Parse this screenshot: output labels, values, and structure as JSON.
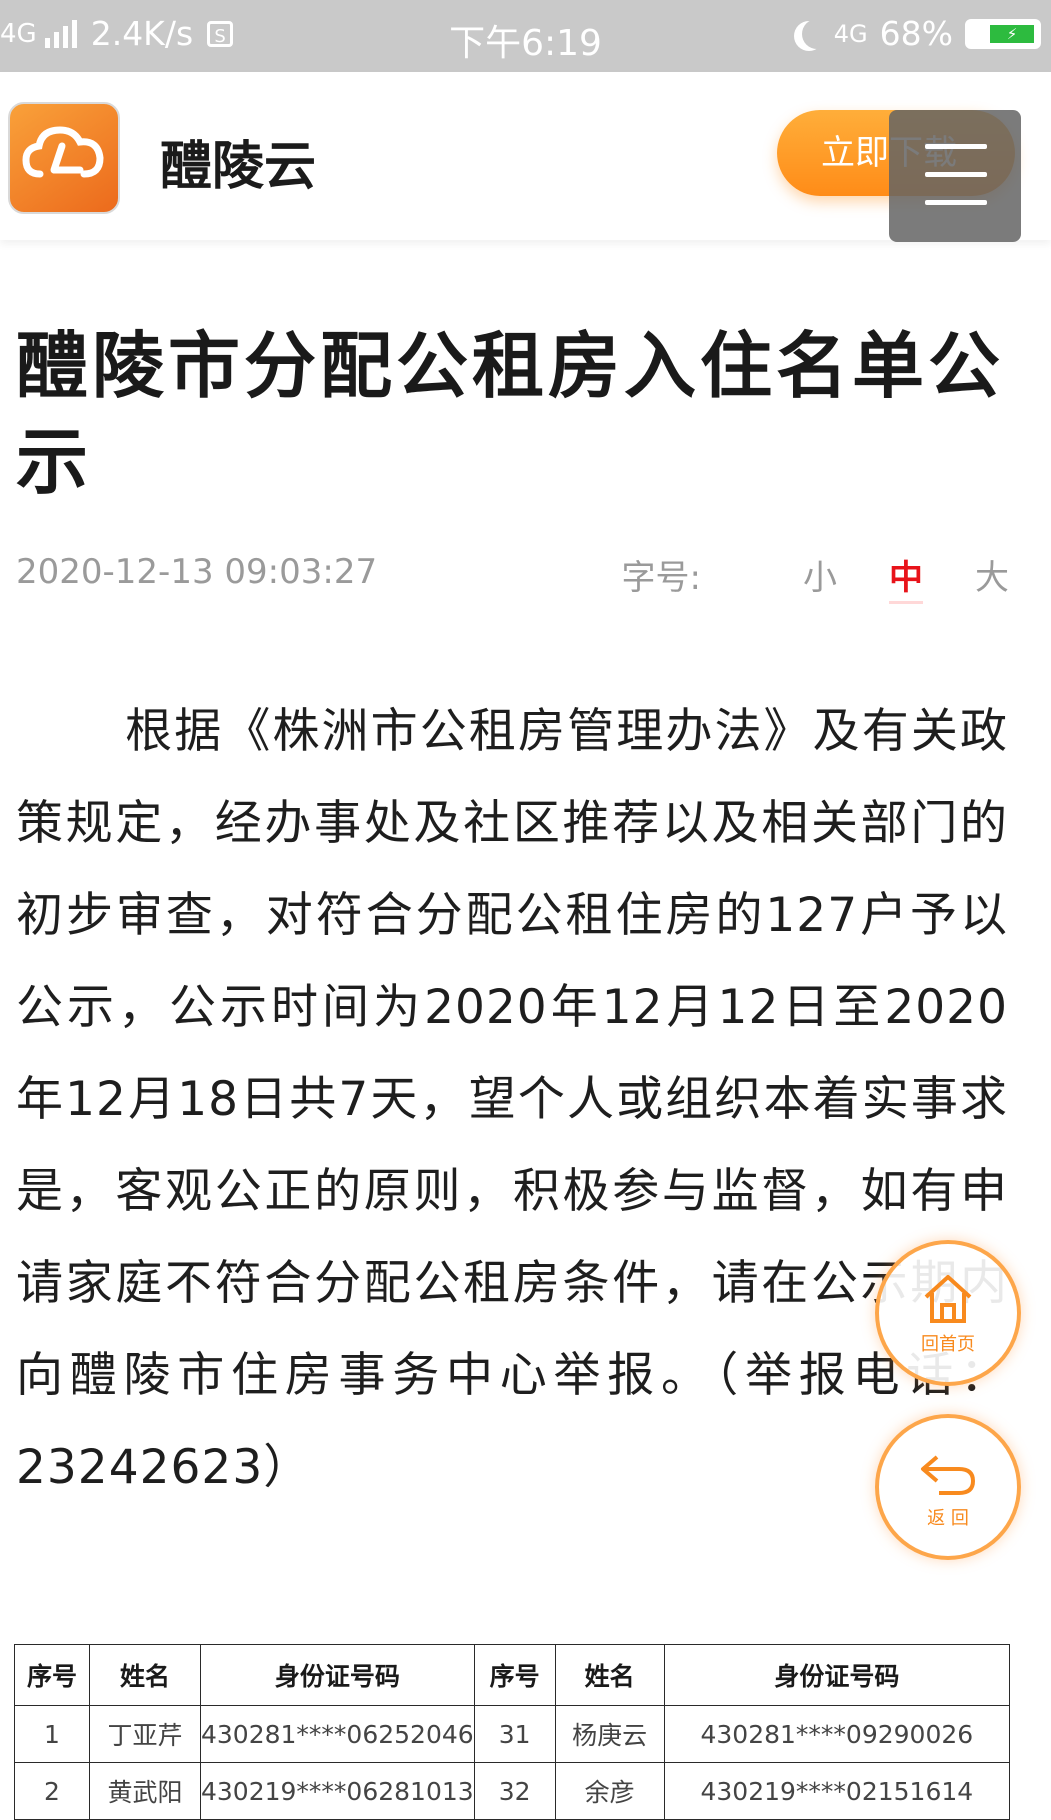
{
  "status_bar": {
    "network": "4G",
    "speed": "2.4K/s",
    "sim_icon": "S",
    "time": "下午6:19",
    "net_type_right": "4G",
    "battery": "68%"
  },
  "header": {
    "app_name": "醴陵云",
    "download_label": "立即下载",
    "icons": {
      "logo": "cloud-logo-icon",
      "menu": "hamburger-menu-icon"
    }
  },
  "article": {
    "title": "醴陵市分配公租房入住名单公示",
    "date": "2020-12-13 09:03:27",
    "font_size_label": "字号:",
    "font_size_options": [
      "小",
      "中",
      "大"
    ],
    "font_size_selected": "中",
    "body": "根据《株洲市公租房管理办法》及有关政策规定，经办事处及社区推荐以及相关部门的初步审查，对符合分配公租住房的127户予以公示，公示时间为2020年12月12日至2020年12月18日共7天，望个人或组织本着实事求是，客观公正的原则，积极参与监督，如有申请家庭不符合分配公租房条件，请在公示期内向醴陵市住房事务中心举报。（举报电话：23242623）"
  },
  "table": {
    "headers": [
      "序号",
      "姓名",
      "身份证号码",
      "序号",
      "姓名",
      "身份证号码"
    ],
    "rows": [
      [
        "1",
        "丁亚芹",
        "430281****06252046",
        "31",
        "杨庚云",
        "430281****09290026"
      ],
      [
        "2",
        "黄武阳",
        "430219****06281013",
        "32",
        "余彦",
        "430219****02151614"
      ]
    ]
  },
  "floating": {
    "home_label": "回首页",
    "back_label": "返 回",
    "icons": {
      "home": "home-icon",
      "back": "back-arrow-icon"
    }
  },
  "colors": {
    "accent_orange": "#ff8c18",
    "active_red": "#e8131a",
    "status_bar_bg": "#c9c9c9"
  }
}
